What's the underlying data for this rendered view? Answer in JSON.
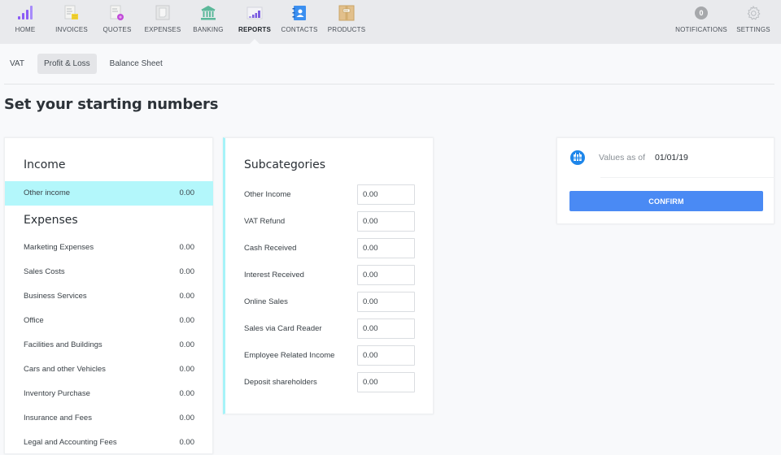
{
  "nav": {
    "items": [
      {
        "label": "HOME",
        "icon": "bar-chart-icon",
        "color": "#8b5cf6"
      },
      {
        "label": "INVOICES",
        "icon": "invoice-icon",
        "color": "#f2d43a"
      },
      {
        "label": "QUOTES",
        "icon": "quote-icon",
        "color": "#c04bd8"
      },
      {
        "label": "EXPENSES",
        "icon": "expense-icon",
        "color": "#c9cbcd"
      },
      {
        "label": "BANKING",
        "icon": "bank-icon",
        "color": "#5cb89a"
      },
      {
        "label": "REPORTS",
        "icon": "report-icon",
        "color": "#7b5ce0",
        "active": true
      },
      {
        "label": "CONTACTS",
        "icon": "contacts-icon",
        "color": "#3b8ff0"
      },
      {
        "label": "PRODUCTS",
        "icon": "product-box-icon",
        "color": "#d9b378"
      }
    ],
    "notifications": {
      "label": "NOTIFICATIONS",
      "count": "0"
    },
    "settings": {
      "label": "SETTINGS"
    }
  },
  "subtabs": [
    {
      "label": "VAT"
    },
    {
      "label": "Profit & Loss",
      "active": true
    },
    {
      "label": "Balance Sheet"
    }
  ],
  "page_title": "Set your starting numbers",
  "categories": {
    "income_heading": "Income",
    "income": [
      {
        "name": "Other income",
        "value": "0.00",
        "selected": true
      }
    ],
    "expenses_heading": "Expenses",
    "expenses": [
      {
        "name": "Marketing Expenses",
        "value": "0.00"
      },
      {
        "name": "Sales Costs",
        "value": "0.00"
      },
      {
        "name": "Business Services",
        "value": "0.00"
      },
      {
        "name": "Office",
        "value": "0.00"
      },
      {
        "name": "Facilities and Buildings",
        "value": "0.00"
      },
      {
        "name": "Cars and other Vehicles",
        "value": "0.00"
      },
      {
        "name": "Inventory Purchase",
        "value": "0.00"
      },
      {
        "name": "Insurance and Fees",
        "value": "0.00"
      },
      {
        "name": "Legal and Accounting Fees",
        "value": "0.00"
      }
    ]
  },
  "subcategories": {
    "title": "Subcategories",
    "items": [
      {
        "name": "Other Income",
        "value": "0.00"
      },
      {
        "name": "VAT Refund",
        "value": "0.00"
      },
      {
        "name": "Cash Received",
        "value": "0.00"
      },
      {
        "name": "Interest Received",
        "value": "0.00"
      },
      {
        "name": "Online Sales",
        "value": "0.00"
      },
      {
        "name": "Sales via Card Reader",
        "value": "0.00"
      },
      {
        "name": "Employee Related Income",
        "value": "0.00"
      },
      {
        "name": "Deposit shareholders",
        "value": "0.00"
      }
    ]
  },
  "summary": {
    "values_label": "Values as of",
    "date": "01/01/19",
    "confirm_label": "CONFIRM",
    "accent": "#4a8af4",
    "icon": "calendar-icon"
  },
  "colors": {
    "selected_row": "#b3f7fb",
    "accent_border": "#a6f3f8"
  }
}
